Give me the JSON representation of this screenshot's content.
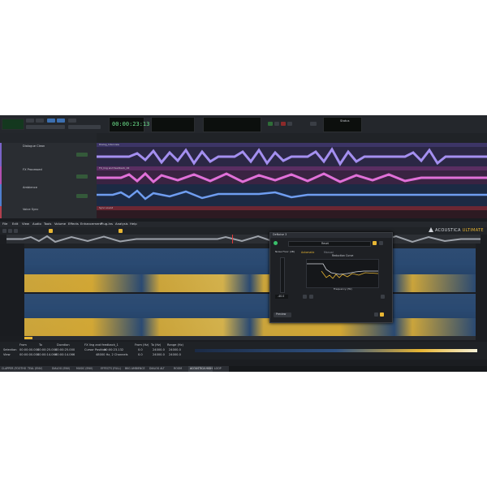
{
  "transport": {
    "time": "00:00:23:13",
    "status_label": "Status"
  },
  "tracks": [
    {
      "name": "Dialogue Clean",
      "clip": "Dialog_Interview",
      "color": "#7a63c8"
    },
    {
      "name": "FX Processed",
      "clip": "FX_ling and feedback_02",
      "color": "#b24fb1"
    },
    {
      "name": "Ambience",
      "clip": "",
      "color": "#4f7fcf"
    },
    {
      "name": "Voice Sync",
      "clip": "Sync sound",
      "color": "#b23f4e"
    }
  ],
  "editor": {
    "menu": [
      "File",
      "Edit",
      "View",
      "Audio",
      "Tools",
      "Volume",
      "Effects",
      "Enhancement",
      "Plug-Ins",
      "Analysis",
      "Help"
    ],
    "brand": "ACOUSTICA",
    "brand_suffix": "ULTIMATE"
  },
  "deNoise": {
    "title": "DeNoise 3",
    "preset": "Reset",
    "noise_floor_label": "Noise Floor (dB)",
    "noise_floor_value": "-40.0",
    "mode_auto": "Automatic",
    "mode_manual": "Manual",
    "curve_title": "Reduction Curve",
    "x_axis_label": "Frequency (Hz)",
    "preview_label": "Preview"
  },
  "selection": {
    "row_labels": [
      "Selection",
      "View"
    ],
    "col_labels": [
      "From",
      "To",
      "Duration"
    ],
    "values": [
      [
        "00:00:00.000",
        "00:00:25.000",
        "00:00:25.000"
      ],
      [
        "00:00:00.000",
        "00:00:14.066",
        "00:00:14.066"
      ]
    ],
    "file_label": "FX ling and feedback_1",
    "cursor_label": "Cursor Position",
    "cursor_value": "00:00:23.132",
    "format": "48000 Hz, 2 Channels"
  },
  "freq": {
    "labels": [
      "From (Hz)",
      "To (Hz)",
      "Range (Hz)"
    ],
    "values": [
      [
        "0.0",
        "24000.0",
        "24000.0"
      ],
      [
        "0.0",
        "24000.0",
        "24000.0"
      ]
    ]
  },
  "tabs": [
    "CLAPPER (FOOTHOLDER)",
    "TEAL (ENV)",
    "DIALOG (ENV)",
    "MUSIC (ENV)",
    "EFFECTS (FULL)",
    "BKG AMBIENCE",
    "DIALOG ALT",
    "ROOM",
    "ACOUSTICA HIGH",
    "LOOP"
  ],
  "colors": {
    "accent": "#e8b634",
    "spec_low": "#1e3658",
    "spec_high": "#f0b92d",
    "green": "#3ac06b"
  }
}
